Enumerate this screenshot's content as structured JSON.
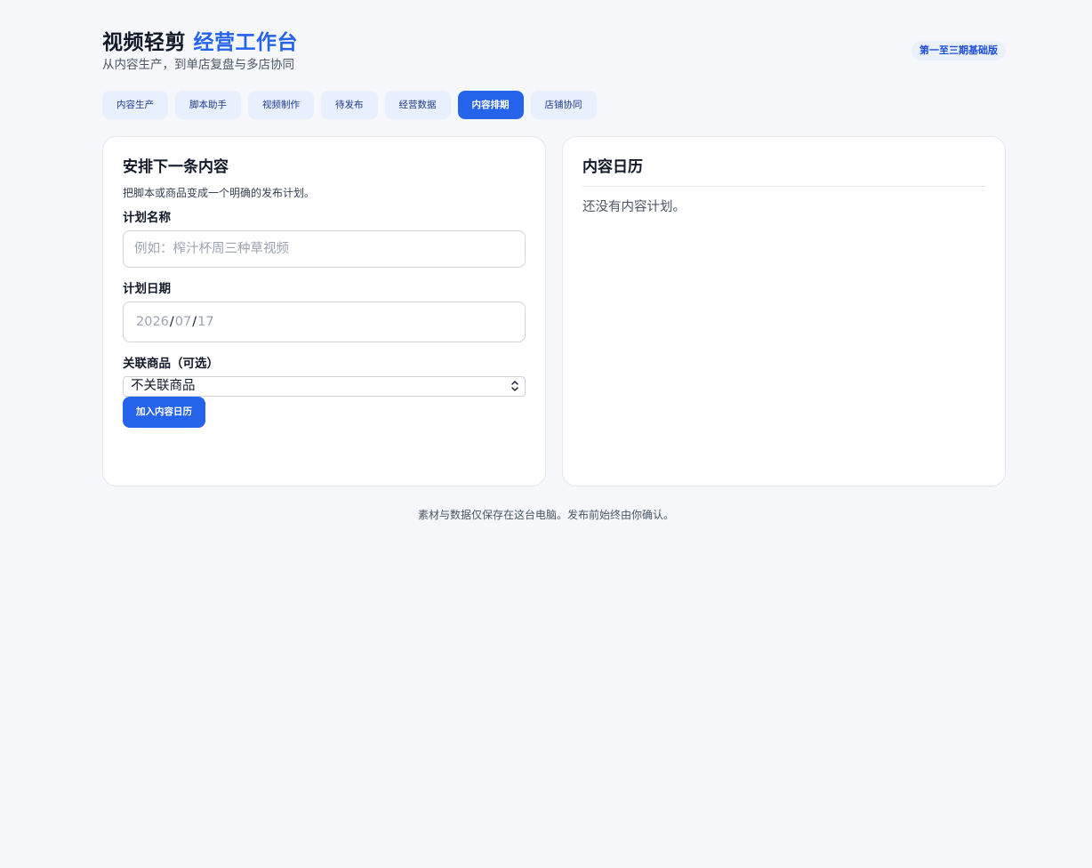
{
  "header": {
    "title_main": "视频轻剪",
    "title_accent": "经营工作台",
    "subtitle": "从内容生产，到单店复盘与多店协同",
    "edition_badge": "第一至三期基础版"
  },
  "tabs": [
    {
      "label": "内容生产",
      "active": false
    },
    {
      "label": "脚本助手",
      "active": false
    },
    {
      "label": "视频制作",
      "active": false
    },
    {
      "label": "待发布",
      "active": false
    },
    {
      "label": "经营数据",
      "active": false
    },
    {
      "label": "内容排期",
      "active": true
    },
    {
      "label": "店铺协同",
      "active": false
    }
  ],
  "schedule_form": {
    "title": "安排下一条内容",
    "description": "把脚本或商品变成一个明确的发布计划。",
    "plan_name_label": "计划名称",
    "plan_name_placeholder": "例如：榨汁杯周三种草视频",
    "plan_date_label": "计划日期",
    "plan_date": {
      "year": "2026",
      "month": "07",
      "day": "17",
      "separator": "/"
    },
    "product_label": "关联商品（可选）",
    "product_selected": "不关联商品",
    "submit_label": "加入内容日历"
  },
  "calendar": {
    "title": "内容日历",
    "empty_text": "还没有内容计划。"
  },
  "footer": {
    "note": "素材与数据仅保存在这台电脑。发布前始终由你确认。"
  },
  "colors": {
    "accent": "#2563eb",
    "background": "#f5f7fb",
    "tab_inactive_bg": "#e8efff"
  }
}
